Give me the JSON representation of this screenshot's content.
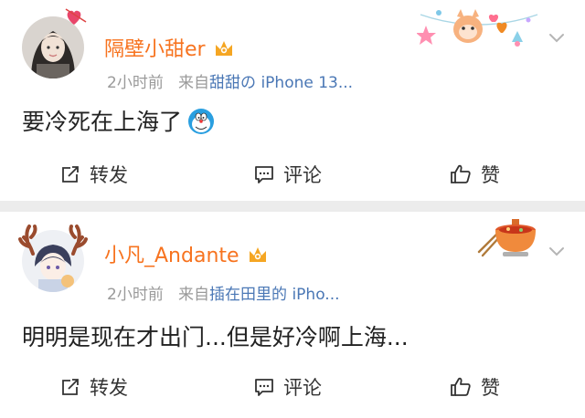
{
  "posts": [
    {
      "username": "隔壁小甜er",
      "time": "2小时前",
      "from_label": "来自",
      "source": "甜甜の iPhone 13...",
      "text": "要冷死在上海了",
      "avatar_icon": "girl-avatar-icon",
      "emoji": "doraemon-emoji"
    },
    {
      "username": "小凡_Andante",
      "time": "2小时前",
      "from_label": "来自",
      "source": "插在田里的 iPho...",
      "text": "明明是现在才出门...但是好冷啊上海...",
      "avatar_icon": "anime-avatar-icon",
      "emoji": ""
    }
  ],
  "actions": {
    "repost": "转发",
    "comment": "评论",
    "like": "赞"
  },
  "colors": {
    "username": "#f7731f",
    "source_link": "#4a77b5",
    "meta": "#9a9a9a",
    "separator": "#ececec"
  }
}
